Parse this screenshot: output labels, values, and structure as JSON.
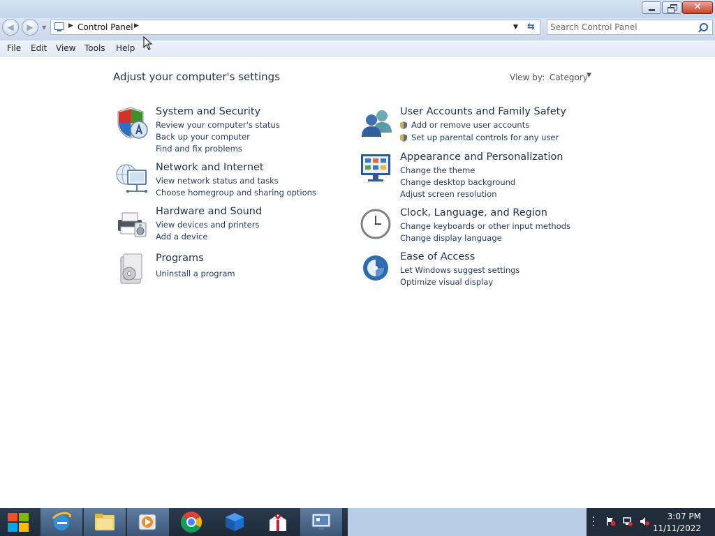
{
  "window": {
    "minimize": "minimize",
    "maximize": "restore",
    "close": "close"
  },
  "nav": {
    "breadcrumb_root": "Control Panel",
    "search_placeholder": "Search Control Panel"
  },
  "menu": [
    "File",
    "Edit",
    "View",
    "Tools",
    "Help"
  ],
  "main": {
    "title": "Adjust your computer's settings",
    "view_by_label": "View by:",
    "view_by_value": "Category"
  },
  "categories": {
    "system": {
      "title": "System and Security",
      "links": [
        "Review your computer's status",
        "Back up your computer",
        "Find and fix problems"
      ]
    },
    "network": {
      "title": "Network and Internet",
      "links": [
        "View network status and tasks",
        "Choose homegroup and sharing options"
      ]
    },
    "hardware": {
      "title": "Hardware and Sound",
      "links": [
        "View devices and printers",
        "Add a device"
      ]
    },
    "programs": {
      "title": "Programs",
      "links": [
        "Uninstall a program"
      ]
    },
    "users": {
      "title": "User Accounts and Family Safety",
      "links": [
        "Add or remove user accounts",
        "Set up parental controls for any user"
      ]
    },
    "appearance": {
      "title": "Appearance and Personalization",
      "links": [
        "Change the theme",
        "Change desktop background",
        "Adjust screen resolution"
      ]
    },
    "clock": {
      "title": "Clock, Language, and Region",
      "links": [
        "Change keyboards or other input methods",
        "Change display language"
      ]
    },
    "ease": {
      "title": "Ease of Access",
      "links": [
        "Let Windows suggest settings",
        "Optimize visual display"
      ]
    }
  },
  "taskbar": {
    "pinned": [
      "start-icon",
      "internet-explorer-icon",
      "file-explorer-icon",
      "media-player-icon",
      "chrome-icon",
      "app-box-icon",
      "app-gift-icon",
      "remote-desktop-icon"
    ],
    "time": "3:07 PM",
    "date": "11/11/2022"
  },
  "colors": {
    "accent": "#1e3250",
    "link": "#1f3b5f",
    "taskbar": "#1d2a38"
  }
}
